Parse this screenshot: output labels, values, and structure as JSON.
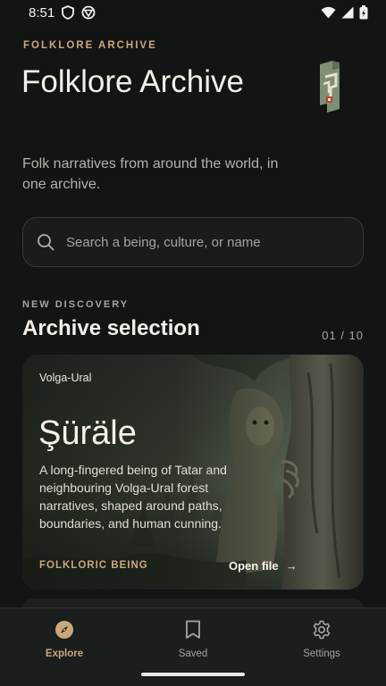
{
  "status_bar": {
    "time": "8:51"
  },
  "header": {
    "eyebrow": "FOLKLORE ARCHIVE",
    "title": "Folklore Archive",
    "subtitle": "Folk narratives from around the world, in one archive."
  },
  "search": {
    "placeholder": "Search a being, culture, or name"
  },
  "section": {
    "eyebrow": "NEW DISCOVERY",
    "title": "Archive selection",
    "pager": "01 / 10"
  },
  "card": {
    "region": "Volga-Ural",
    "title": "Şüräle",
    "description": "A long-fingered being of Tatar and neighbouring Volga-Ural forest narratives, shaped around paths, boundaries, and human cunning.",
    "tag": "FOLKLORIC BEING",
    "action": "Open file",
    "action_arrow": "→"
  },
  "nav": {
    "items": [
      {
        "label": "Explore",
        "icon": "compass-icon",
        "active": true
      },
      {
        "label": "Saved",
        "icon": "bookmark-icon",
        "active": false
      },
      {
        "label": "Settings",
        "icon": "gear-icon",
        "active": false
      }
    ]
  },
  "colors": {
    "background": "#121514",
    "accent": "#c9a97a",
    "text": "#ece8df",
    "muted": "#a8a59e"
  }
}
